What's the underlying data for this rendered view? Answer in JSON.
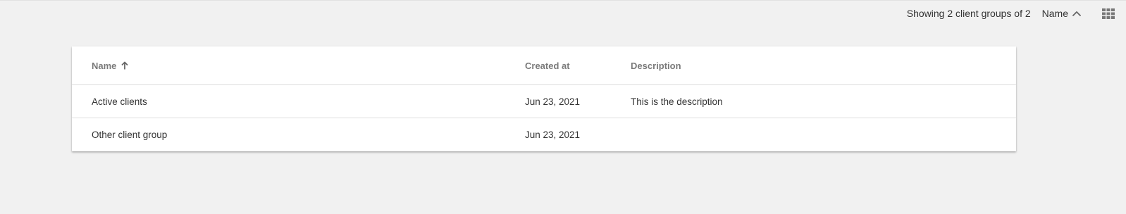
{
  "toolbar": {
    "count_text": "Showing 2 client groups of 2",
    "sort_label": "Name",
    "sort_icon": "chevron-up-icon",
    "view_icon": "grid-view-icon"
  },
  "table": {
    "columns": [
      {
        "label": "Name",
        "sorted": "ascending",
        "sort_icon": "arrow-up-icon"
      },
      {
        "label": "Created at"
      },
      {
        "label": "Description"
      }
    ],
    "rows": [
      {
        "name": "Active clients",
        "created_at": "Jun 23, 2021",
        "description": "This is the description"
      },
      {
        "name": "Other client group",
        "created_at": "Jun 23, 2021",
        "description": ""
      }
    ]
  },
  "colors": {
    "background": "#f1f1f1",
    "card": "#ffffff",
    "header_text": "#7a7a7a",
    "body_text": "#333333",
    "icon": "#666666"
  }
}
